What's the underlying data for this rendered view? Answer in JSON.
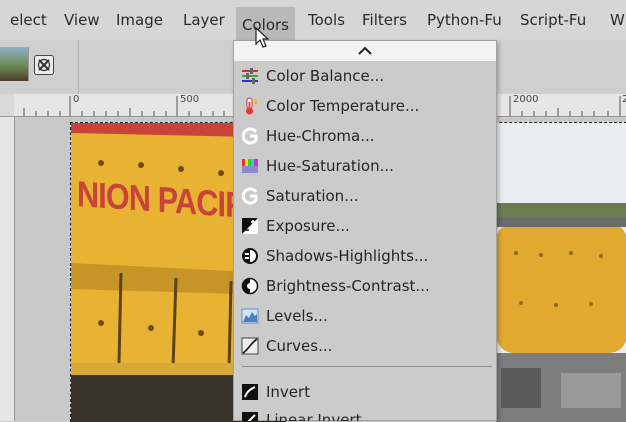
{
  "menubar": {
    "items": [
      {
        "label": "elect"
      },
      {
        "label": "View"
      },
      {
        "label": "Image"
      },
      {
        "label": "Layer"
      },
      {
        "label": "Colors",
        "active": true
      },
      {
        "label": "Tools"
      },
      {
        "label": "Filters"
      },
      {
        "label": "Python-Fu"
      },
      {
        "label": "Script-Fu"
      },
      {
        "label": "W"
      }
    ]
  },
  "ruler": {
    "labels": [
      "0",
      "500",
      "2000",
      "2"
    ]
  },
  "colors_menu": {
    "scroll_up_icon": "chevron-up-icon",
    "items": [
      {
        "label": "Color Balance...",
        "icon": "color-balance-icon"
      },
      {
        "label": "Color Temperature...",
        "icon": "thermometer-icon"
      },
      {
        "label": "Hue-Chroma...",
        "icon": "gegl-icon"
      },
      {
        "label": "Hue-Saturation...",
        "icon": "hue-saturation-icon"
      },
      {
        "label": "Saturation...",
        "icon": "gegl-icon"
      },
      {
        "label": "Exposure...",
        "icon": "exposure-icon"
      },
      {
        "label": "Shadows-Highlights...",
        "icon": "shadows-highlights-icon"
      },
      {
        "label": "Brightness-Contrast...",
        "icon": "brightness-contrast-icon"
      },
      {
        "label": "Levels...",
        "icon": "levels-icon"
      },
      {
        "label": "Curves...",
        "icon": "curves-icon"
      },
      {
        "label": "Invert",
        "icon": "invert-icon"
      },
      {
        "label": "Linear Invert",
        "icon": "linear-invert-icon"
      }
    ]
  },
  "image": {
    "text": "NION PACIFIC"
  },
  "colors": {
    "menubar_bg": "#d6d6d6",
    "menu_bg": "#cbcbcb",
    "train_yellow": "#e8b233",
    "train_red": "#c8443b"
  }
}
